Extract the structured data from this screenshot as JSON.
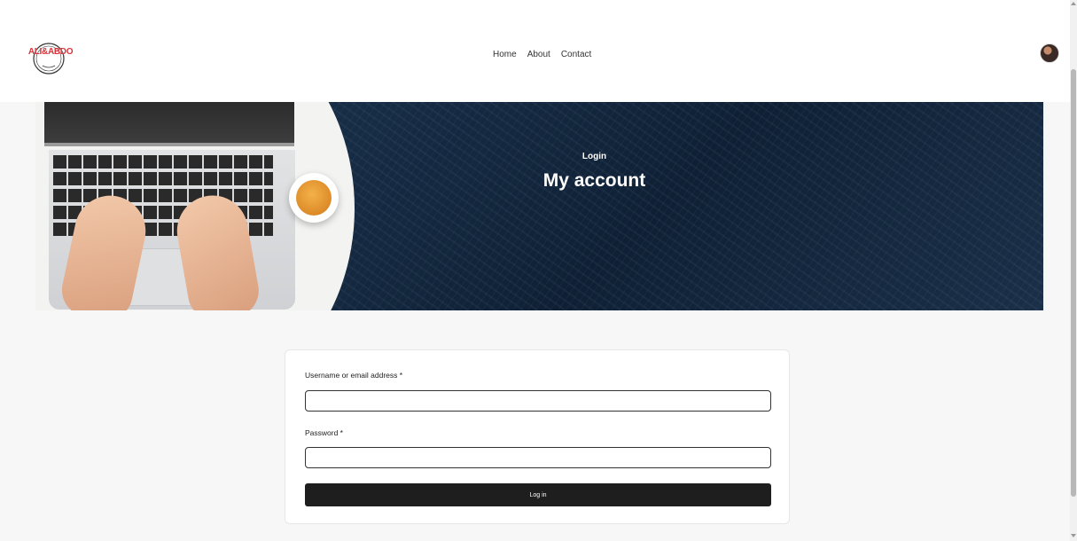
{
  "header": {
    "logo_text": "ALI&ABDO",
    "logo_icon": "circle-logo-icon",
    "nav": [
      {
        "label": "Home"
      },
      {
        "label": "About"
      },
      {
        "label": "Contact"
      }
    ],
    "avatar_icon": "user-avatar"
  },
  "hero": {
    "subtitle": "Login",
    "title": "My account"
  },
  "login": {
    "username_label": "Username or email address *",
    "username_value": "",
    "password_label": "Password *",
    "password_value": "",
    "submit_label": "Log in"
  }
}
